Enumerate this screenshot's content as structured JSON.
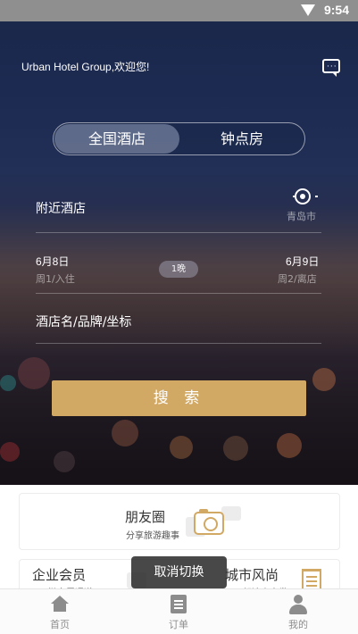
{
  "status_bar": {
    "time": "9:54"
  },
  "header": {
    "welcome": "Urban Hotel Group,欢迎您!"
  },
  "tabs": {
    "active": "全国酒店",
    "inactive": "钟点房"
  },
  "search": {
    "nearby_label": "附近酒店",
    "city": "青岛市",
    "checkin_date": "6月8日",
    "checkin_sub": "周1/入住",
    "nights": "1晚",
    "checkout_date": "6月9日",
    "checkout_sub": "周2/离店",
    "keyword_placeholder": "酒店名/品牌/坐标",
    "button_label": "搜 索"
  },
  "cards": {
    "moments_title": "朋友圈",
    "moments_sub": "分享旅游趣事",
    "member_title": "企业会员",
    "member_sub": "一键专属通道",
    "fashion_title": "城市风尚",
    "fashion_sub": "一起达人出发"
  },
  "toast": "取消切换",
  "tabbar": {
    "home": "首页",
    "orders": "订单",
    "mine": "我的"
  },
  "colors": {
    "accent": "#d1a864",
    "status_bar": "#8f8f8f"
  }
}
